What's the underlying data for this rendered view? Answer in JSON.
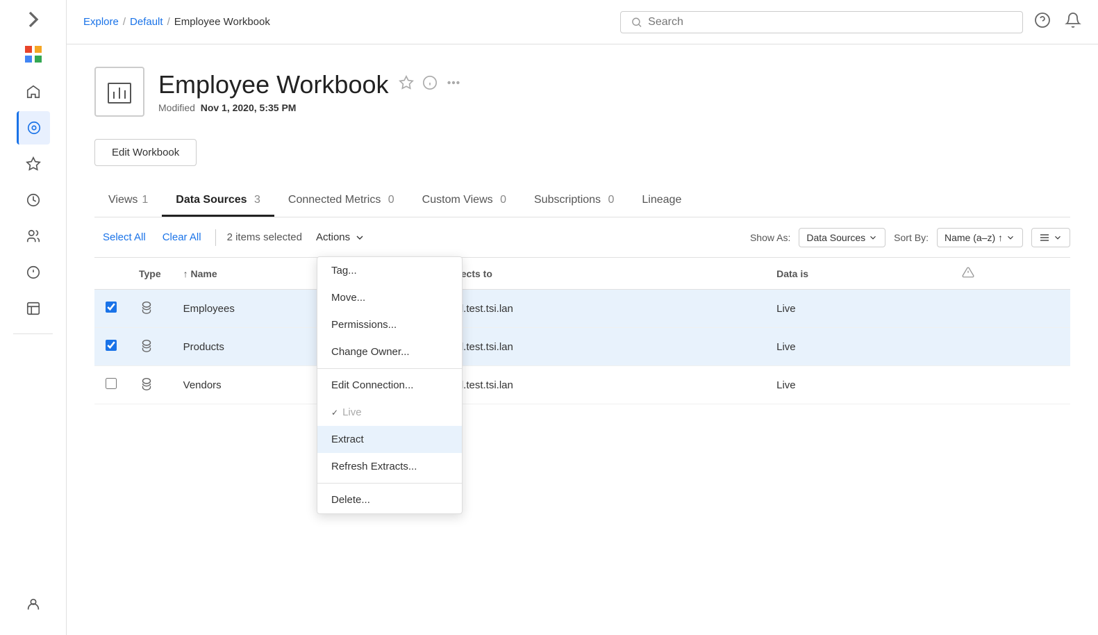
{
  "sidebar": {
    "toggle_icon": "▶",
    "brand_icon": "✦",
    "items": [
      {
        "id": "home",
        "icon": "⌂",
        "label": "Home",
        "active": false
      },
      {
        "id": "explore",
        "icon": "◎",
        "label": "Explore",
        "active": true
      },
      {
        "id": "favorites",
        "icon": "☆",
        "label": "Favorites",
        "active": false
      },
      {
        "id": "recents",
        "icon": "⏱",
        "label": "Recents",
        "active": false
      },
      {
        "id": "shared",
        "icon": "👥",
        "label": "Shared",
        "active": false
      },
      {
        "id": "suggestions",
        "icon": "💡",
        "label": "Suggestions",
        "active": false
      },
      {
        "id": "collections",
        "icon": "📦",
        "label": "Collections",
        "active": false
      }
    ],
    "bottom_item": {
      "id": "users",
      "icon": "👤",
      "label": "Users"
    }
  },
  "topbar": {
    "breadcrumb": {
      "explore": "Explore",
      "default": "Default",
      "current": "Employee Workbook",
      "sep": "/"
    },
    "search_placeholder": "Search",
    "help_icon": "?",
    "notification_icon": "🔔"
  },
  "workbook": {
    "title": "Employee Workbook",
    "modified_label": "Modified",
    "modified_date": "Nov 1, 2020, 5:35 PM",
    "edit_button": "Edit Workbook"
  },
  "tabs": [
    {
      "id": "views",
      "label": "Views",
      "count": "1",
      "active": false
    },
    {
      "id": "data-sources",
      "label": "Data Sources",
      "count": "3",
      "active": true
    },
    {
      "id": "connected-metrics",
      "label": "Connected Metrics",
      "count": "0",
      "active": false
    },
    {
      "id": "custom-views",
      "label": "Custom Views",
      "count": "0",
      "active": false
    },
    {
      "id": "subscriptions",
      "label": "Subscriptions",
      "count": "0",
      "active": false
    },
    {
      "id": "lineage",
      "label": "Lineage",
      "count": "",
      "active": false
    }
  ],
  "toolbar": {
    "select_all": "Select All",
    "clear_all": "Clear All",
    "selected_text": "2 items selected",
    "actions": "Actions",
    "show_as_label": "Show As:",
    "show_as_value": "Data Sources",
    "sort_by_label": "Sort By:",
    "sort_by_value": "Name (a–z) ↑"
  },
  "table": {
    "columns": [
      "",
      "Type",
      "↑ Name",
      "Connects to",
      "Data is",
      "⚠"
    ],
    "rows": [
      {
        "id": "employees",
        "checked": true,
        "name": "Employees",
        "connects_to": "mssql.test.tsi.lan",
        "data_is": "Live",
        "selected": true
      },
      {
        "id": "products",
        "checked": true,
        "name": "Products",
        "connects_to": "mssql.test.tsi.lan",
        "data_is": "Live",
        "selected": true
      },
      {
        "id": "vendors",
        "checked": false,
        "name": "Vendors",
        "connects_to": "mssql.test.tsi.lan",
        "data_is": "Live",
        "selected": false
      }
    ]
  },
  "actions_menu": {
    "items": [
      {
        "id": "tag",
        "label": "Tag...",
        "group": 1,
        "highlighted": false,
        "disabled": false
      },
      {
        "id": "move",
        "label": "Move...",
        "group": 1,
        "highlighted": false,
        "disabled": false
      },
      {
        "id": "permissions",
        "label": "Permissions...",
        "group": 1,
        "highlighted": false,
        "disabled": false
      },
      {
        "id": "change-owner",
        "label": "Change Owner...",
        "group": 1,
        "highlighted": false,
        "disabled": false
      },
      {
        "id": "edit-connection",
        "label": "Edit Connection...",
        "group": 2,
        "highlighted": false,
        "disabled": false
      },
      {
        "id": "live",
        "label": "Live",
        "group": 2,
        "highlighted": false,
        "disabled": true
      },
      {
        "id": "extract",
        "label": "Extract",
        "group": 2,
        "highlighted": true,
        "disabled": false
      },
      {
        "id": "refresh-extracts",
        "label": "Refresh Extracts...",
        "group": 2,
        "highlighted": false,
        "disabled": false
      },
      {
        "id": "delete",
        "label": "Delete...",
        "group": 3,
        "highlighted": false,
        "disabled": false
      }
    ]
  }
}
